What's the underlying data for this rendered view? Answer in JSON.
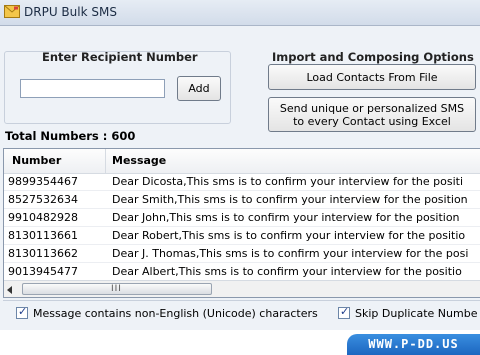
{
  "window": {
    "title": "DRPU Bulk SMS",
    "app_icon": "envelope-icon"
  },
  "recipient": {
    "heading": "Enter Recipient Number",
    "input_value": "",
    "add_label": "Add"
  },
  "import": {
    "heading": "Import and Composing Options",
    "load_label": "Load Contacts From File",
    "send_label_line1": "Send unique or personalized SMS",
    "send_label_line2": "to every Contact using Excel"
  },
  "total_label": "Total Numbers : 600",
  "table": {
    "columns": [
      "Number",
      "Message"
    ],
    "rows": [
      {
        "number": "9899354467",
        "message": "Dear Dicosta,This sms is to confirm your interview for the positi"
      },
      {
        "number": "8527532634",
        "message": "Dear Smith,This sms is to confirm your interview for the position"
      },
      {
        "number": "9910482928",
        "message": "Dear John,This sms is to confirm your interview for the position"
      },
      {
        "number": "8130113661",
        "message": "Dear Robert,This sms is to confirm your interview for the positio"
      },
      {
        "number": "8130113662",
        "message": "Dear J. Thomas,This sms is to confirm your interview for the posi"
      },
      {
        "number": "9013945477",
        "message": "Dear Albert,This sms is to confirm your interview for the positio"
      }
    ],
    "grip": "III"
  },
  "options": {
    "unicode_label": "Message contains non-English (Unicode) characters",
    "skip_label": "Skip Duplicate Numbe",
    "check_mark": "✓"
  },
  "brand": "WWW.P-DD.US",
  "colors": {
    "brand_blue": "#1c66c0",
    "check_blue": "#1e3c8a"
  }
}
